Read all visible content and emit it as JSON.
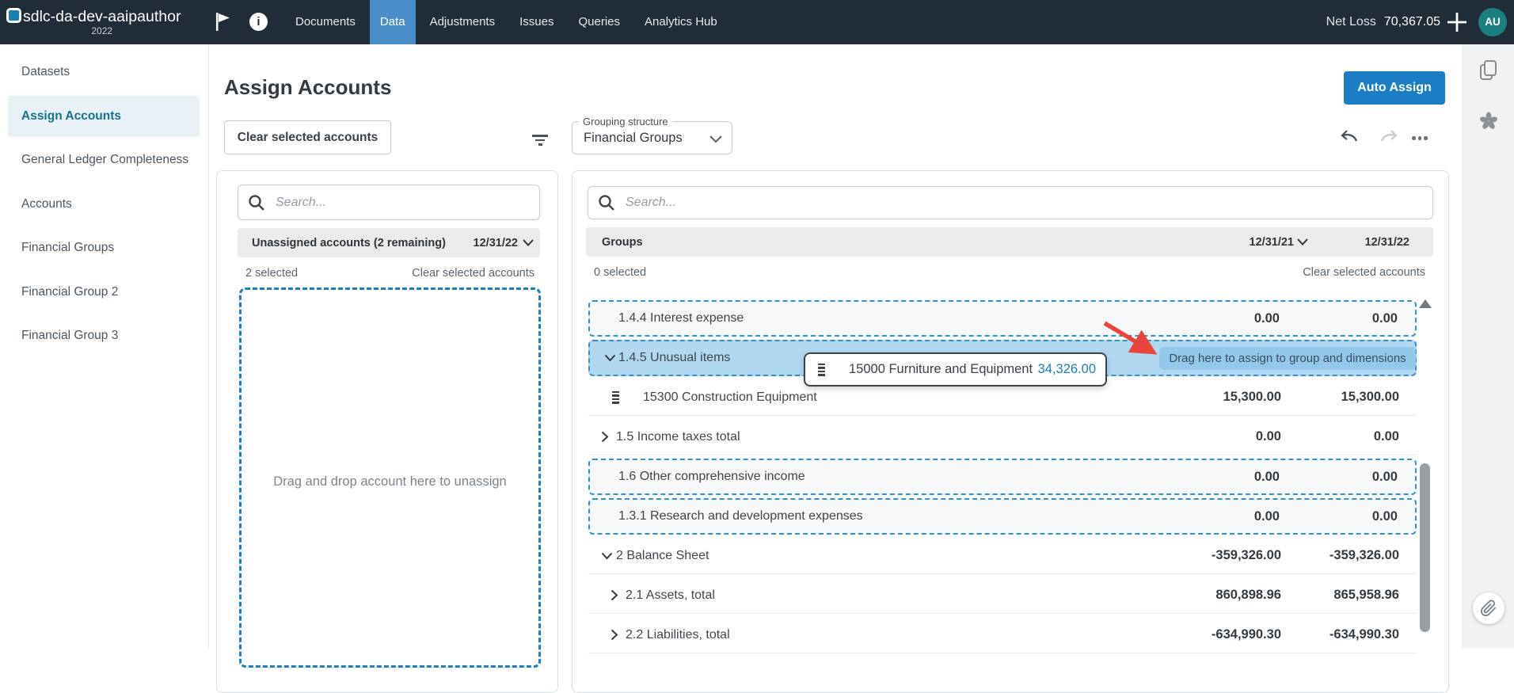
{
  "topbar": {
    "title": "sdlc-da-dev-aaipauthor",
    "year": "2022",
    "nav": [
      "Documents",
      "Data",
      "Adjustments",
      "Issues",
      "Queries",
      "Analytics Hub"
    ],
    "net_loss_label": "Net Loss",
    "net_loss_value": "70,367.05",
    "avatar": "AU"
  },
  "sidebar": {
    "items": [
      "Datasets",
      "Assign Accounts",
      "General Ledger Completeness",
      "Accounts",
      "Financial Groups",
      "Financial Group 2",
      "Financial Group 3"
    ]
  },
  "main": {
    "title": "Assign Accounts",
    "auto_assign_label": "Auto Assign",
    "clear_selected_label": "Clear selected accounts",
    "grouping_label": "Grouping structure",
    "grouping_value": "Financial Groups"
  },
  "left_panel": {
    "search_placeholder": "Search...",
    "header": "Unassigned accounts (2 remaining)",
    "header_date": "12/31/22",
    "selected_count": "2 selected",
    "clear_selected": "Clear selected accounts",
    "dropzone_text": "Drag and drop account here to unassign"
  },
  "right_panel": {
    "search_placeholder": "Search...",
    "header": "Groups",
    "col1": "12/31/21",
    "col2": "12/31/22",
    "selected_count": "0 selected",
    "clear_selected": "Clear selected accounts",
    "chip_text": "Drag here to assign to group and dimensions",
    "rows": [
      {
        "label": "1.4.4 Interest expense",
        "v1": "0.00",
        "v2": "0.00"
      },
      {
        "label": "1.4.5 Unusual items",
        "v1": "",
        "v2": ""
      },
      {
        "label": "15300 Construction Equipment",
        "v1": "15,300.00",
        "v2": "15,300.00"
      },
      {
        "label": "1.5 Income taxes total",
        "v1": "0.00",
        "v2": "0.00"
      },
      {
        "label": "1.6 Other comprehensive income",
        "v1": "0.00",
        "v2": "0.00"
      },
      {
        "label": "1.3.1 Research and development expenses",
        "v1": "0.00",
        "v2": "0.00"
      },
      {
        "label": "2 Balance Sheet",
        "v1": "-359,326.00",
        "v2": "-359,326.00"
      },
      {
        "label": "2.1 Assets, total",
        "v1": "860,898.96",
        "v2": "865,958.96"
      },
      {
        "label": "2.2 Liabilities, total",
        "v1": "-634,990.30",
        "v2": "-634,990.30"
      }
    ],
    "drag_card": {
      "label": "15000 Furniture and Equipment",
      "amount": "34,326.00"
    }
  }
}
